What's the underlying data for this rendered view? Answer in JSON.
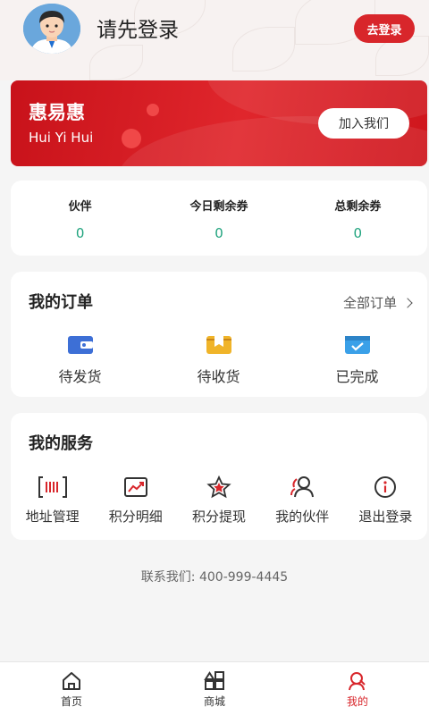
{
  "header": {
    "login_prompt": "请先登录",
    "login_button": "去登录"
  },
  "banner": {
    "brand": "惠易惠",
    "brand_sub": "Hui Yi Hui",
    "join_button": "加入我们"
  },
  "stats": [
    {
      "label": "伙伴",
      "value": "0"
    },
    {
      "label": "今日剩余券",
      "value": "0"
    },
    {
      "label": "总剩余券",
      "value": "0"
    }
  ],
  "orders": {
    "title": "我的订单",
    "all_link": "全部订单",
    "items": [
      {
        "label": "待发货",
        "icon": "wallet-icon"
      },
      {
        "label": "待收货",
        "icon": "box-icon"
      },
      {
        "label": "已完成",
        "icon": "completed-icon"
      }
    ]
  },
  "services": {
    "title": "我的服务",
    "items": [
      {
        "label": "地址管理",
        "icon": "address-icon"
      },
      {
        "label": "积分明细",
        "icon": "chart-icon"
      },
      {
        "label": "积分提现",
        "icon": "star-icon"
      },
      {
        "label": "我的伙伴",
        "icon": "partners-icon"
      },
      {
        "label": "退出登录",
        "icon": "info-icon"
      }
    ]
  },
  "contact": {
    "label": "联系我们:",
    "phone": "400-999-4445"
  },
  "tabbar": [
    {
      "label": "首页",
      "icon": "home-icon",
      "active": false
    },
    {
      "label": "商城",
      "icon": "shop-icon",
      "active": false
    },
    {
      "label": "我的",
      "icon": "profile-icon",
      "active": true
    }
  ],
  "colors": {
    "accent": "#d8262b",
    "stat_value": "#1fa37d",
    "wallet_icon": "#3d6fd6",
    "box_icon": "#f0b429",
    "completed_icon": "#3aa0e8"
  }
}
